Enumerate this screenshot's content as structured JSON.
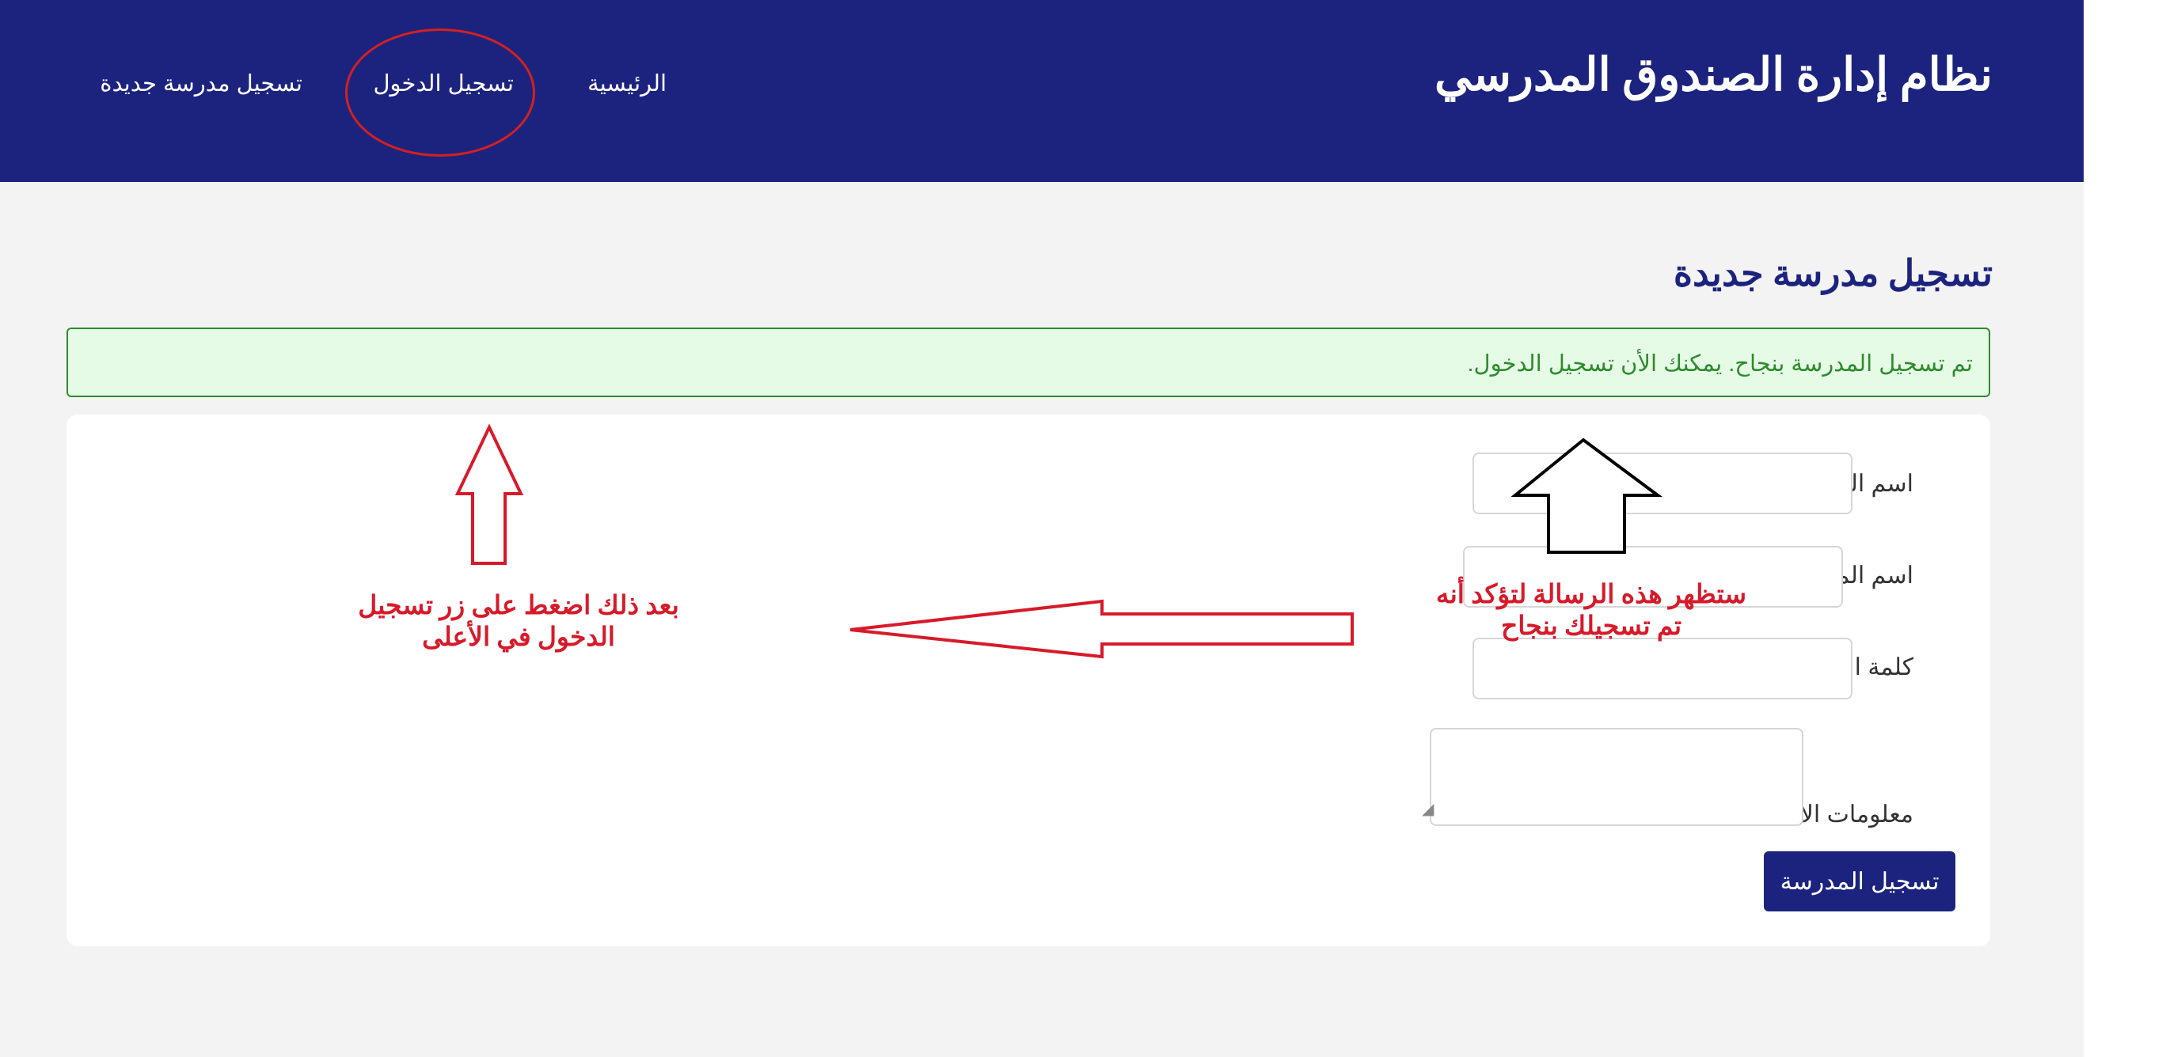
{
  "header": {
    "title": "نظام إدارة الصندوق المدرسي",
    "nav": {
      "home": "الرئيسية",
      "login": "تسجيل الدخول",
      "register": "تسجيل مدرسة جديدة"
    }
  },
  "main": {
    "page_title": "تسجيل مدرسة جديدة",
    "alert": {
      "message": "تم تسجيل المدرسة بنجاح. يمكنك الأن تسجيل الدخول."
    },
    "form": {
      "school_name_label": "اسم المدرسة:",
      "username_label": "اسم المستخدم:",
      "password_label": "كلمة المرور:",
      "contact_label": "معلومات الاتصال:",
      "school_name_value": "",
      "username_value": "",
      "password_value": "",
      "contact_value": "",
      "submit_label": "تسجيل المدرسة"
    }
  },
  "annotations": {
    "left_note": "بعد ذلك اضغط على زر تسجيل الدخول في الأعلى",
    "right_note": "ستظهر هذه الرسالة لتؤكد أنه تم تسجيلك بنجاح"
  },
  "colors": {
    "header_bg": "#1c237e",
    "success_bg": "#e6fbe6",
    "success_text": "#2e8b2e",
    "annotation_red": "#d71a2a"
  }
}
